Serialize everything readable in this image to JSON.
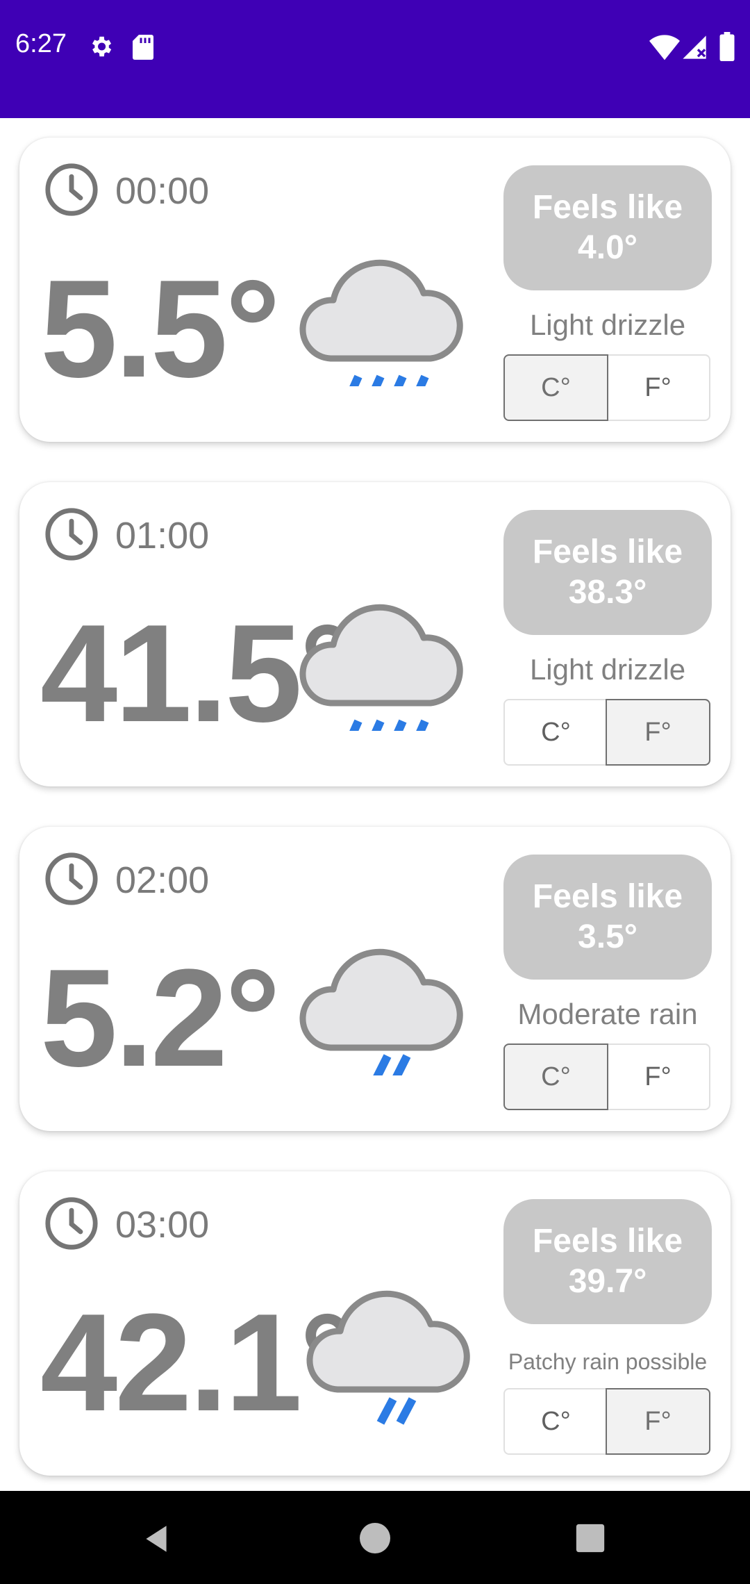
{
  "status_bar": {
    "time": "6:27",
    "icons": [
      "gear-icon",
      "sd-card-icon",
      "wifi-icon",
      "signal-icon",
      "battery-icon"
    ],
    "background_color": "#3f00b5"
  },
  "hourly": [
    {
      "time": "00:00",
      "temp": "5.5°",
      "icon": "light-rain-cloud-icon",
      "feels_like_label": "Feels like",
      "feels_like_value": "4.0°",
      "condition": "Light drizzle",
      "unit_c": "C°",
      "unit_f": "F°",
      "selected_unit": "C"
    },
    {
      "time": "01:00",
      "temp": "41.5°",
      "icon": "light-rain-cloud-icon",
      "feels_like_label": "Feels like",
      "feels_like_value": "38.3°",
      "condition": "Light drizzle",
      "unit_c": "C°",
      "unit_f": "F°",
      "selected_unit": "F"
    },
    {
      "time": "02:00",
      "temp": "5.2°",
      "icon": "rain-cloud-icon",
      "feels_like_label": "Feels like",
      "feels_like_value": "3.5°",
      "condition": "Moderate rain",
      "unit_c": "C°",
      "unit_f": "F°",
      "selected_unit": "C"
    },
    {
      "time": "03:00",
      "temp": "42.1°",
      "icon": "night-rain-cloud-icon",
      "feels_like_label": "Feels like",
      "feels_like_value": "39.7°",
      "condition": "Patchy rain possible",
      "unit_c": "C°",
      "unit_f": "F°",
      "selected_unit": "F"
    }
  ],
  "colors": {
    "accent": "#3f00b5",
    "temp_text": "#808080",
    "pill": "#c8c8c8",
    "rain": "#1a73e8"
  },
  "nav_bar": {
    "icons": [
      "back-icon",
      "home-icon",
      "recents-icon"
    ]
  }
}
